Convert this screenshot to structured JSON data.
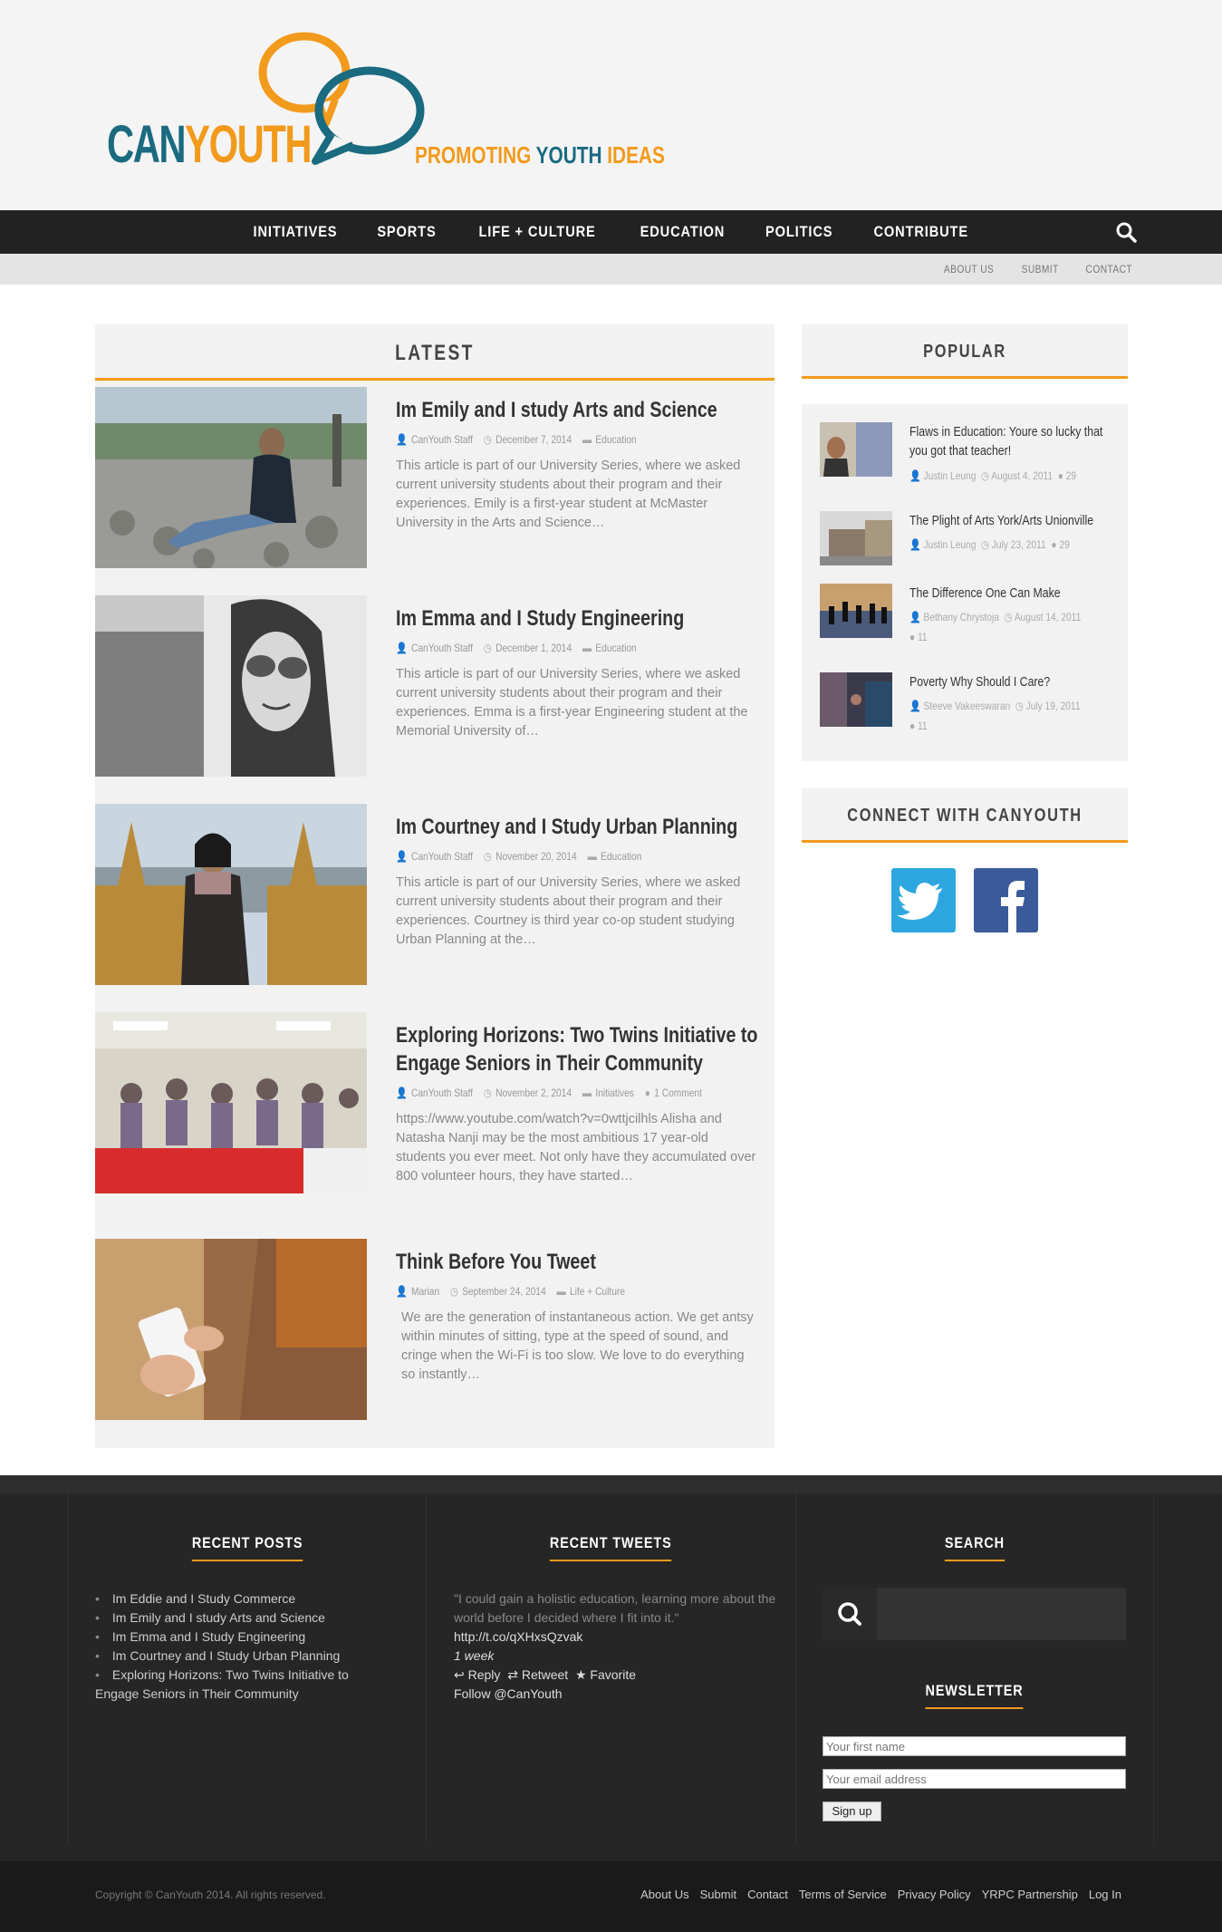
{
  "brand": {
    "name_part1": "CAN",
    "name_part2": "YOUTH",
    "tag_part1": "PROMOTING ",
    "tag_part2": "YOUTH ",
    "tag_part3": "IDEAS"
  },
  "nav": [
    "INITIATIVES",
    "SPORTS",
    "LIFE + CULTURE",
    "EDUCATION",
    "POLITICS",
    "CONTRIBUTE"
  ],
  "subnav": [
    "ABOUT US",
    "SUBMIT",
    "CONTACT"
  ],
  "latest": {
    "heading": "LATEST",
    "articles": [
      {
        "title": "Im Emily and I study Arts and Science",
        "author": "CanYouth Staff",
        "date": "December 7, 2014",
        "category": "Education",
        "comments": "",
        "excerpt": "This article is part of our University Series, where we asked current university students about their program and their experiences. Emily is a first-year student at McMaster University in the Arts and Science…"
      },
      {
        "title": "Im Emma and I Study Engineering",
        "author": "CanYouth Staff",
        "date": "December 1, 2014",
        "category": "Education",
        "comments": "",
        "excerpt": "This article is part of our University Series, where we asked current university students about their program and their experiences. Emma is a first-year Engineering student at the Memorial University of…"
      },
      {
        "title": "Im Courtney and I Study Urban Planning",
        "author": "CanYouth Staff",
        "date": "November 20, 2014",
        "category": "Education",
        "comments": "",
        "excerpt": "This article is part of our University Series, where we asked current university students about their program and their experiences. Courtney is third year co-op student studying Urban Planning at the…"
      },
      {
        "title": "Exploring Horizons: Two Twins Initiative to Engage Seniors in Their Community",
        "author": "CanYouth Staff",
        "date": "November 2, 2014",
        "category": "Initiatives",
        "comments": "1 Comment",
        "excerpt": "https://www.youtube.com/watch?v=0wttjcilhls Alisha and Natasha Nanji may be the most ambitious 17 year-old students you ever meet. Not only have they accumulated over 800 volunteer hours, they have started…"
      },
      {
        "title": "Think Before You Tweet",
        "author": "Marian",
        "date": "September 24, 2014",
        "category": "Life + Culture",
        "comments": "",
        "excerpt": "We are the generation of instantaneous action. We get antsy within minutes of sitting, type at the speed of sound, and cringe when the Wi-Fi is too slow. We love to do everything so instantly…"
      }
    ]
  },
  "popular": {
    "heading": "POPULAR",
    "items": [
      {
        "title": "Flaws in Education: Youre so lucky that you got that teacher!",
        "author": "Justin Leung",
        "date": "August 4, 2011",
        "comments": "29"
      },
      {
        "title": "The Plight of Arts York/Arts Unionville",
        "author": "Justin Leung",
        "date": "July 23, 2011",
        "comments": "29"
      },
      {
        "title": "The Difference One Can Make",
        "author": "Bethany Chrystoja",
        "date": "August 14, 2011",
        "comments": "11"
      },
      {
        "title": "Poverty Why Should I Care?",
        "author": "Steeve Vakeeswaran",
        "date": "July 19, 2011",
        "comments": "11"
      }
    ]
  },
  "connect": {
    "heading": "CONNECT WITH CANYOUTH"
  },
  "footer": {
    "recent_heading": "RECENT POSTS",
    "recent_posts": [
      "Im Eddie and I Study Commerce",
      "Im Emily and I study Arts and Science",
      "Im Emma and I Study Engineering",
      "Im Courtney and I Study Urban Planning",
      "Exploring Horizons: Two Twins Initiative to Engage Seniors in Their Community"
    ],
    "tweets_heading": "RECENT TWEETS",
    "tweet_text": "\"I could gain a holistic education, learning more about the world before I decided where I fit into it.\"",
    "tweet_link": "http://t.co/qXHxsQzvak",
    "tweet_time": "1 week",
    "tweet_reply": "Reply",
    "tweet_retweet": "Retweet",
    "tweet_favorite": "Favorite",
    "follow": "Follow @CanYouth",
    "search_heading": "SEARCH",
    "newsletter_heading": "NEWSLETTER",
    "first_name_placeholder": "Your first name",
    "email_placeholder": "Your email address",
    "signup": "Sign up"
  },
  "copyright": "Copyright © CanYouth 2014. All rights reserved.",
  "footer_links": [
    "About Us",
    "Submit",
    "Contact",
    "Terms of Service",
    "Privacy Policy",
    "YRPC Partnership",
    "Log In"
  ],
  "colors": {
    "accent": "#f29a1c",
    "teal": "#1a6a80",
    "nav_bg": "#222222",
    "twitter": "#2ea7e0",
    "facebook": "#3a5a99"
  }
}
